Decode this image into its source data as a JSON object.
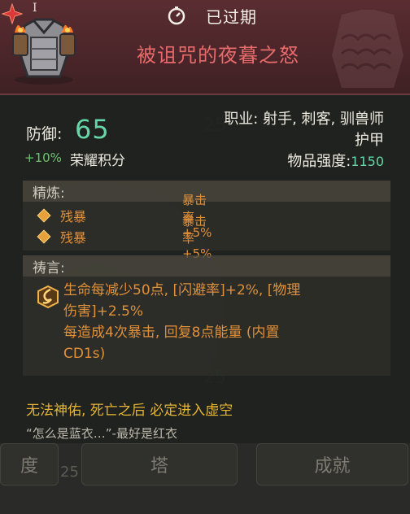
{
  "background": {
    "numbers": [
      "25",
      "25",
      "25",
      "25",
      "25",
      "25",
      "25"
    ],
    "buttons": [
      "度",
      "塔",
      "成就"
    ]
  },
  "header": {
    "status": "已过期",
    "item_name": "被诅咒的夜暮之怒",
    "tier": "I"
  },
  "stats": {
    "defense_label": "防御:",
    "defense_value": "65",
    "honor_pct": "+10%",
    "honor_label": "荣耀积分",
    "classes": "职业: 射手, 刺客, 驯兽师",
    "item_type": "护甲",
    "strength_label": "物品强度:",
    "strength_value": "1150"
  },
  "refine": {
    "title": "精炼:",
    "items": [
      {
        "name": "残暴",
        "effect": "暴击率+5%"
      },
      {
        "name": "残暴",
        "effect": "暴击率+5%"
      }
    ]
  },
  "prayer": {
    "title": "祷言:",
    "line1": "生命每减少50点, [闪避率]+2%, [物理",
    "line2": "伤害]+2.5%",
    "line3": "每造成4次暴击, 回复8点能量 (内置",
    "line4": "CD1s)"
  },
  "curse_text": "无法神佑, 死亡之后 必定进入虚空",
  "quote_text": "“怎么是蓝衣…”-最好是红衣",
  "colors": {
    "header_bg": "#4a2529",
    "item_name": "#e86b6b",
    "defense": "#66d6a8",
    "orange_text": "#e0903a",
    "curse_text": "#e6b432"
  }
}
